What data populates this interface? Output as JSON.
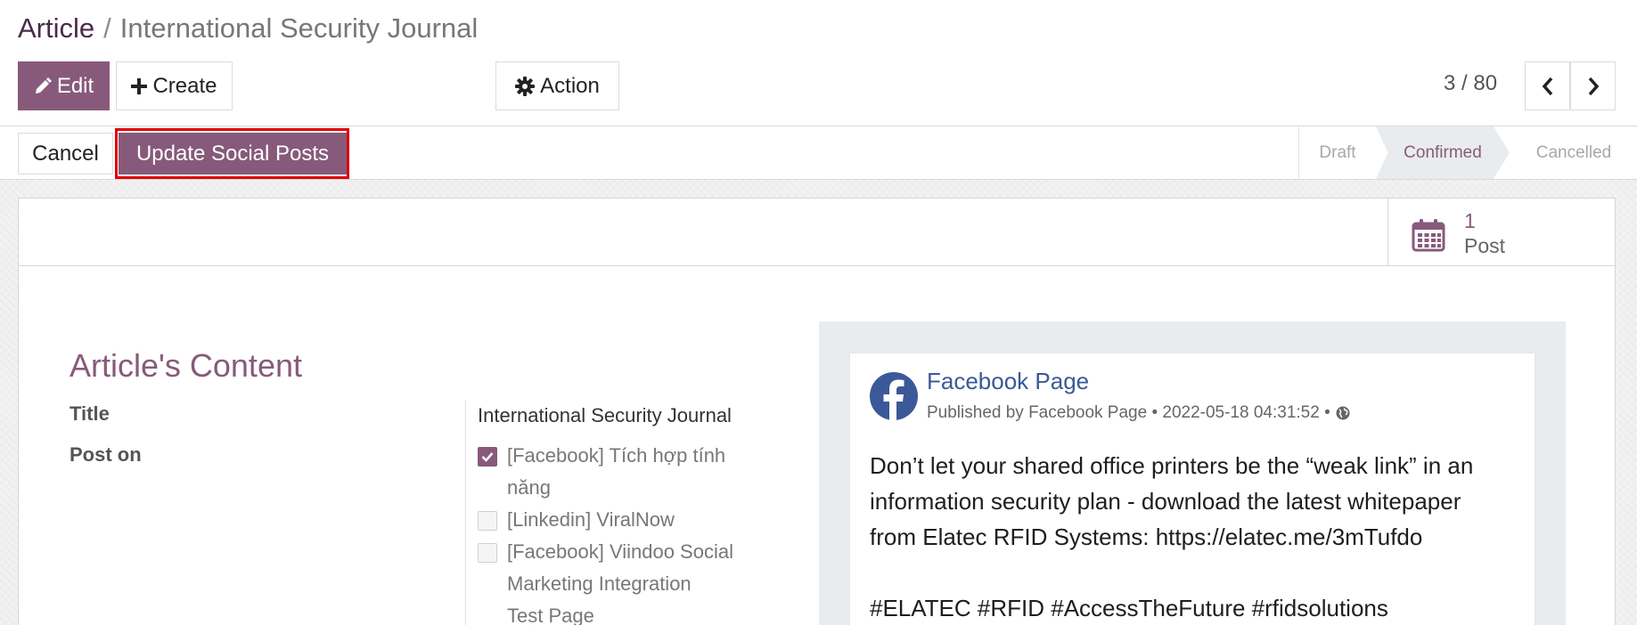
{
  "breadcrumb": {
    "root": "Article",
    "separator": "/",
    "current": "International Security Journal"
  },
  "toolbar": {
    "edit_label": "Edit",
    "create_label": "Create",
    "action_label": "Action"
  },
  "pager": {
    "value": "3 / 80"
  },
  "statusbar": {
    "cancel_label": "Cancel",
    "update_label": "Update Social Posts",
    "stages": [
      "Draft",
      "Confirmed",
      "Cancelled"
    ],
    "active_stage": "Confirmed"
  },
  "stat_button": {
    "value": "1",
    "label": "Post",
    "icon": "calendar-icon"
  },
  "form": {
    "section_title": "Article's Content",
    "title_label": "Title",
    "title_value": "International Security Journal",
    "post_on_label": "Post on",
    "accounts": [
      {
        "label_line1": "[Facebook] Tích hợp tính",
        "label_line2": "năng",
        "checked": true
      },
      {
        "label_line1": "[Linkedin] ViralNow",
        "checked": false
      },
      {
        "label_line1": "[Facebook] Viindoo Social",
        "label_line2": "Marketing Integration",
        "label_line3": "Test Page",
        "checked": false
      }
    ]
  },
  "preview": {
    "page_name": "Facebook Page",
    "meta": "Published by Facebook Page • 2022-05-18 04:31:52 •",
    "body_lines": [
      "Don’t let your shared office printers be the “weak link” in an",
      "information security plan - download the latest whitepaper",
      "from Elatec RFID Systems: https://elatec.me/3mTufdo"
    ],
    "tags": "#ELATEC #RFID #AccessTheFuture #rfidsolutions"
  },
  "colors": {
    "brand": "#875a7b",
    "highlight": "#e00000",
    "facebook": "#3b5998"
  }
}
